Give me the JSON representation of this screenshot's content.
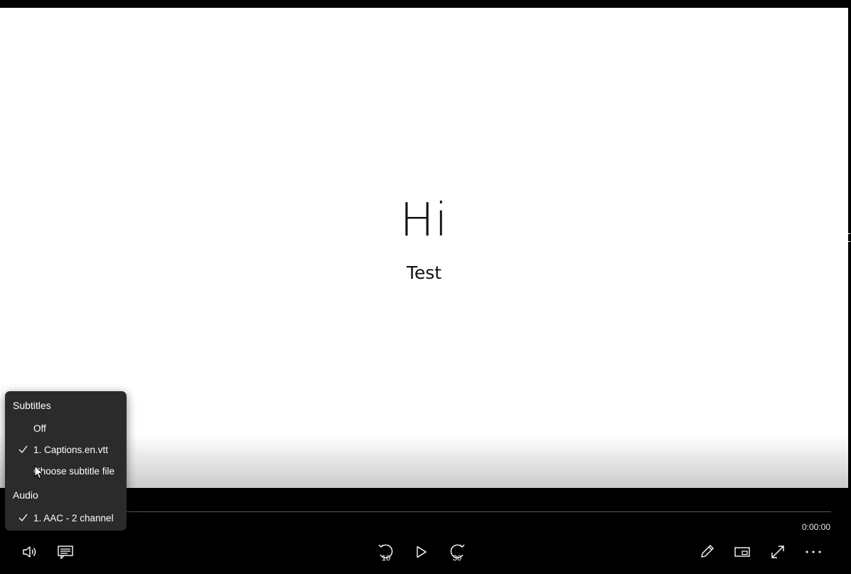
{
  "video": {
    "title_text": "Hi",
    "subtitle_text": "Test"
  },
  "player": {
    "time": "0:00:00",
    "progress": 0,
    "skip_back_seconds": "10",
    "skip_forward_seconds": "30"
  },
  "menu": {
    "subtitles_header": "Subtitles",
    "subtitle_options": [
      {
        "label": "Off",
        "selected": false
      },
      {
        "label": "1. Captions.en.vtt",
        "selected": true
      },
      {
        "label": "Choose subtitle file",
        "selected": false
      }
    ],
    "audio_header": "Audio",
    "audio_options": [
      {
        "label": "1. AAC - 2 channel",
        "selected": true
      }
    ]
  },
  "icons": {
    "volume": "volume-icon",
    "subtitles": "subtitles-icon",
    "skip_back": "skip-back-10-icon",
    "play": "play-icon",
    "skip_forward": "skip-forward-30-icon",
    "edit": "pencil-icon",
    "mini_view": "mini-view-icon",
    "fullscreen": "fullscreen-icon",
    "more": "more-options-icon"
  },
  "colors": {
    "menu_background": "#2b2b2b",
    "control_bar": "#000000",
    "video_background": "#ffffff"
  }
}
